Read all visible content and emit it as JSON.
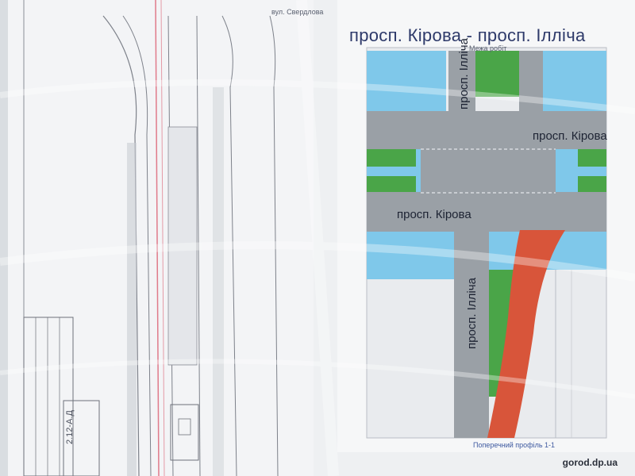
{
  "poster": {
    "title": "просп. Кірова - просп. Ілліча",
    "boundary_label": "Межа робіт",
    "street_kirova_right": "просп. Кірова",
    "street_kirova_left": "просп. Кірова",
    "street_illicha_top": "просп. Ілліча",
    "street_illicha_bottom": "просп. Ілліча",
    "bottom_caption": "Поперечний профіль 1-1"
  },
  "drawing": {
    "stamp_code": "2.12-А.Д",
    "street_label_top": "вул. Свердлова"
  },
  "watermark": "gorod.dp.ua",
  "colors": {
    "road": "#9aa0a6",
    "sidewalk": "#7fc8ea",
    "green": "#4aa548",
    "bike_lane": "#d8553a",
    "title": "#2e3a6a"
  }
}
